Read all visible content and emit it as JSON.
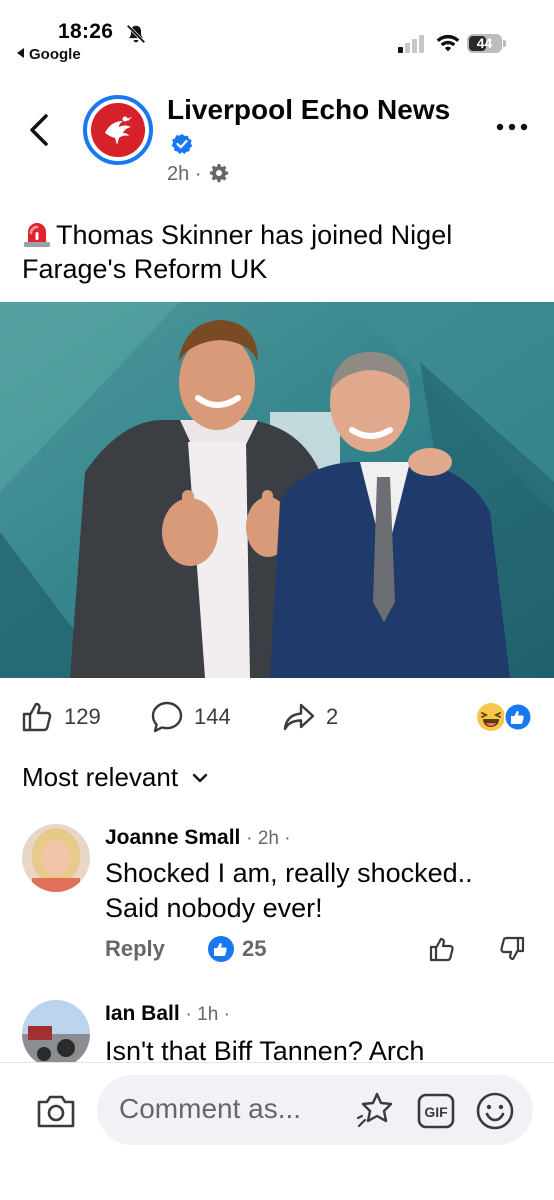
{
  "status_bar": {
    "time": "18:26",
    "back_app": "Google",
    "battery": "44"
  },
  "post": {
    "page_name": "Liverpool Echo News",
    "time_ago": "2h",
    "meta_separator": "·",
    "text": "Thomas Skinner has joined Nigel Farage's Reform UK",
    "likes": "129",
    "comments": "144",
    "shares": "2"
  },
  "comments_section": {
    "sort_label": "Most relevant",
    "items": [
      {
        "author": "Joanne Small",
        "time": "· 2h ·",
        "text": "Shocked I am, really shocked.. Said nobody ever!",
        "reply_label": "Reply",
        "likes": "25"
      },
      {
        "author": "Ian Ball",
        "time": "· 1h ·",
        "text": "Isn't that Biff Tannen? Arch"
      }
    ]
  },
  "composer": {
    "placeholder": "Comment as..."
  },
  "colors": {
    "facebook_blue": "#1877f2",
    "page_red": "#d6202a",
    "muted_text": "#65676b"
  }
}
